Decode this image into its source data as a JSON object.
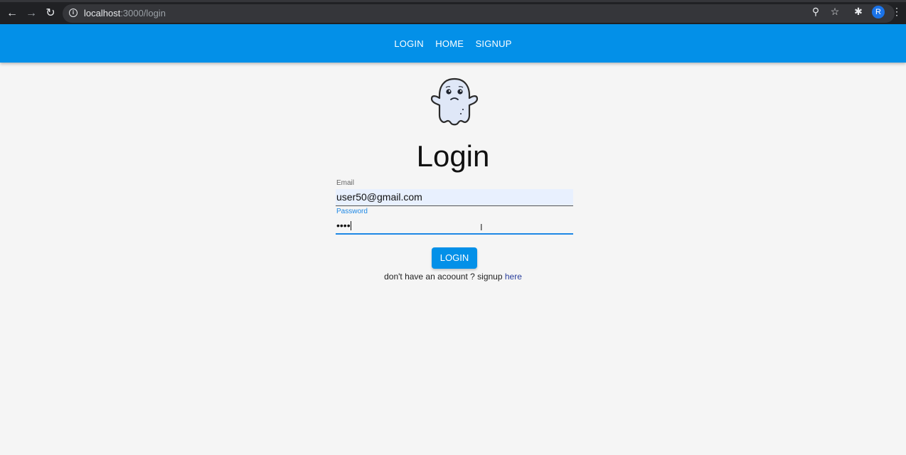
{
  "browser": {
    "url_host": "localhost",
    "url_rest": ":3000/login",
    "avatar_letter": "R"
  },
  "nav": {
    "items": [
      "LOGIN",
      "HOME",
      "SIGNUP"
    ]
  },
  "page": {
    "title": "Login",
    "email_label": "Email",
    "email_value": "user50@gmail.com",
    "password_label": "Password",
    "password_value": "••••",
    "login_button": "LOGIN",
    "signup_text": "don't have an acoount ? signup",
    "signup_link": "here"
  },
  "colors": {
    "appbar": "#0390e8",
    "accent": "#1e88e5",
    "autofill": "#e8f0fe"
  }
}
